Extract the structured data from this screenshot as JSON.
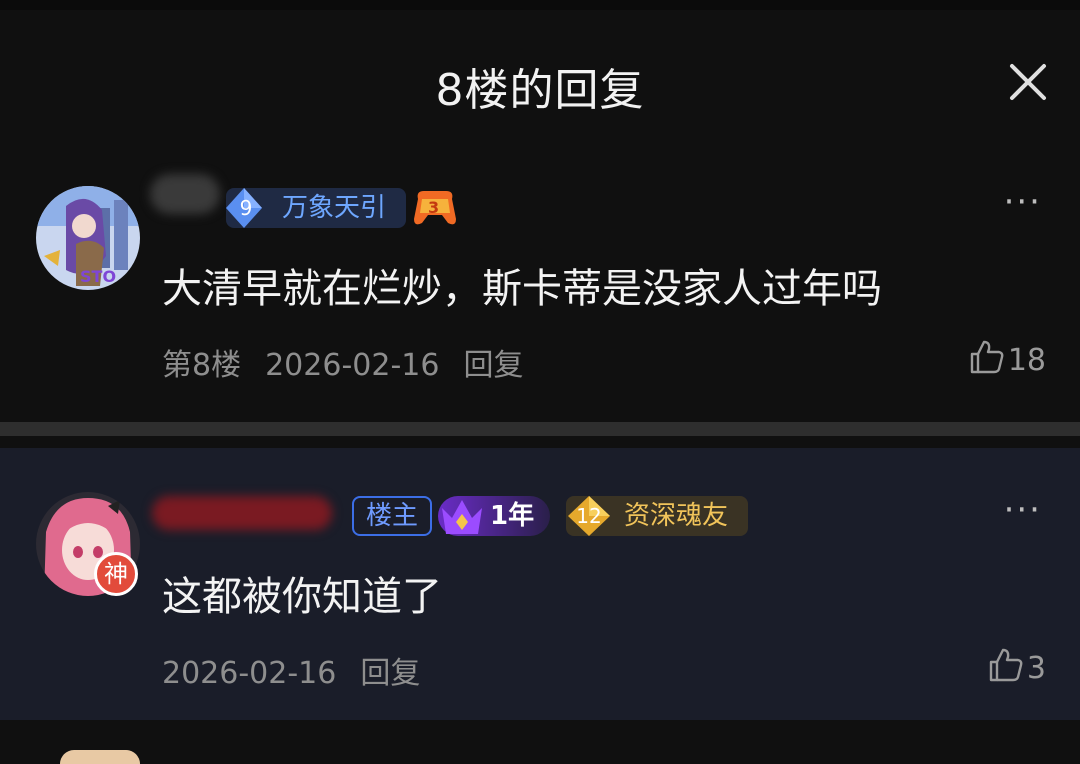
{
  "header": {
    "title": "8楼的回复"
  },
  "comments": [
    {
      "badge_level": "9",
      "badge_title": "万象天引",
      "game_level": "3",
      "content": "大清早就在烂炒，斯卡蒂是没家人过年吗",
      "floor": "第8楼",
      "date": "2026-02-16",
      "reply": "回复",
      "likes": "18",
      "more": "···"
    },
    {
      "op_tag": "楼主",
      "year_tag": "1年",
      "badge_level": "12",
      "badge_title": "资深魂友",
      "avatar_badge": "神",
      "content": "这都被你知道了",
      "date": "2026-02-16",
      "reply": "回复",
      "likes": "3",
      "more": "···"
    }
  ],
  "colors": {
    "background": "#101010",
    "reply_card": "#1a1d29",
    "accent_blue": "#6ea7ff",
    "accent_gold": "#f1c45a",
    "god_badge": "#e24b3b"
  },
  "icons": [
    "close-icon",
    "more-icon",
    "thumbs-up-icon",
    "diamond-level-icon",
    "controller-icon",
    "crown-icon"
  ]
}
